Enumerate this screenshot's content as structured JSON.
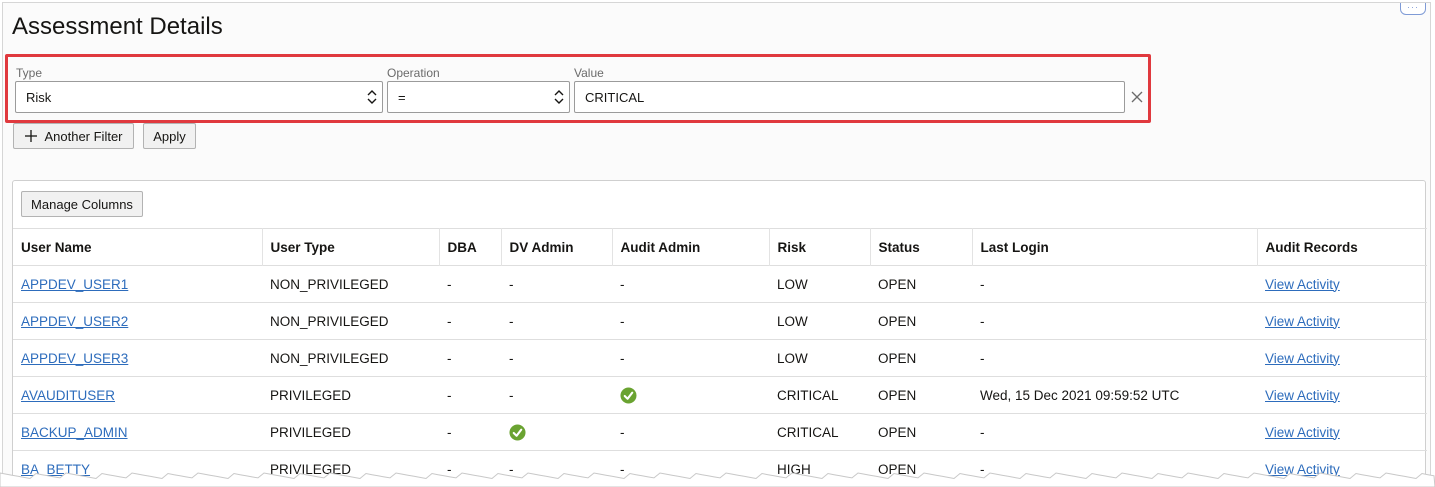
{
  "page": {
    "title": "Assessment Details"
  },
  "filter": {
    "type_label": "Type",
    "type_value": "Risk",
    "operation_label": "Operation",
    "operation_value": "=",
    "value_label": "Value",
    "value_value": "CRITICAL"
  },
  "buttons": {
    "another_filter": "Another Filter",
    "apply": "Apply",
    "manage_columns": "Manage Columns"
  },
  "table": {
    "columns": [
      "User Name",
      "User Type",
      "DBA",
      "DV Admin",
      "Audit Admin",
      "Risk",
      "Status",
      "Last Login",
      "Audit Records"
    ],
    "rows": [
      [
        "APPDEV_USER1",
        "NON_PRIVILEGED",
        "-",
        "-",
        "-",
        "LOW",
        "OPEN",
        "-",
        "View Activity"
      ],
      [
        "APPDEV_USER2",
        "NON_PRIVILEGED",
        "-",
        "-",
        "-",
        "LOW",
        "OPEN",
        "-",
        "View Activity"
      ],
      [
        "APPDEV_USER3",
        "NON_PRIVILEGED",
        "-",
        "-",
        "-",
        "LOW",
        "OPEN",
        "-",
        "View Activity"
      ],
      [
        "AVAUDITUSER",
        "PRIVILEGED",
        "-",
        "-",
        "check",
        "CRITICAL",
        "OPEN",
        "Wed, 15 Dec 2021 09:59:52 UTC",
        "View Activity"
      ],
      [
        "BACKUP_ADMIN",
        "PRIVILEGED",
        "-",
        "check",
        "-",
        "CRITICAL",
        "OPEN",
        "-",
        "View Activity"
      ],
      [
        "BA_BETTY",
        "PRIVILEGED",
        "-",
        "-",
        "-",
        "HIGH",
        "OPEN",
        "-",
        "View Activity"
      ]
    ]
  },
  "colors": {
    "highlight_border": "#e0393e",
    "link": "#2d6cbc",
    "check": "#6aa331"
  },
  "icons": {
    "select_chevron": "chevron-up-down-icon",
    "clear": "close-icon",
    "add": "plus-icon",
    "granted": "check-circle-icon"
  }
}
